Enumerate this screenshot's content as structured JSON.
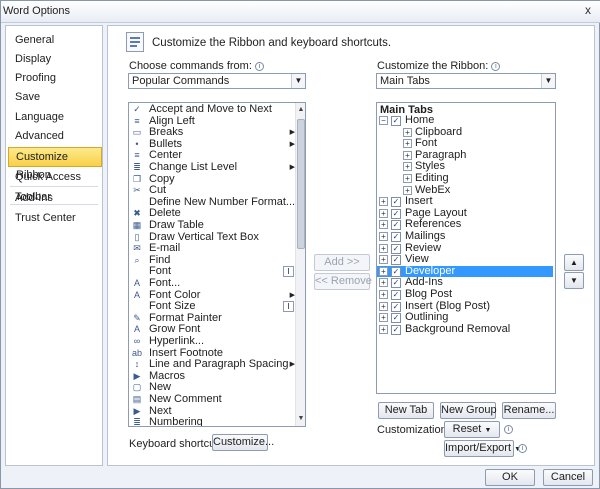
{
  "window": {
    "title": "Word Options",
    "close_glyph": "x"
  },
  "nav": {
    "items": [
      {
        "label": "General"
      },
      {
        "label": "Display"
      },
      {
        "label": "Proofing"
      },
      {
        "label": "Save"
      },
      {
        "label": "Language"
      },
      {
        "label": "Advanced"
      },
      {
        "label": "Customize Ribbon",
        "active": true
      },
      {
        "label": "Quick Access Toolbar"
      },
      {
        "label": "Add-Ins"
      },
      {
        "label": "Trust Center"
      }
    ]
  },
  "main": {
    "heading": "Customize the Ribbon and keyboard shortcuts.",
    "choose_label": "Choose commands from:",
    "choose_value": "Popular Commands",
    "customize_label": "Customize the Ribbon:",
    "customize_value": "Main Tabs",
    "commands": [
      {
        "label": "Accept and Move to Next",
        "icon": "accept-icon",
        "glyph": "✓"
      },
      {
        "label": "Align Left",
        "icon": "align-left-icon",
        "glyph": "≡"
      },
      {
        "label": "Breaks",
        "icon": "breaks-icon",
        "glyph": "▭",
        "submenu": true
      },
      {
        "label": "Bullets",
        "icon": "bullets-icon",
        "glyph": "•",
        "submenu": true
      },
      {
        "label": "Center",
        "icon": "center-icon",
        "glyph": "≡"
      },
      {
        "label": "Change List Level",
        "icon": "list-level-icon",
        "glyph": "≣",
        "submenu": true
      },
      {
        "label": "Copy",
        "icon": "copy-icon",
        "glyph": "❐"
      },
      {
        "label": "Cut",
        "icon": "cut-icon",
        "glyph": "✂"
      },
      {
        "label": "Define New Number Format...",
        "icon": "",
        "glyph": ""
      },
      {
        "label": "Delete",
        "icon": "delete-icon",
        "glyph": "✖"
      },
      {
        "label": "Draw Table",
        "icon": "draw-table-icon",
        "glyph": "▦"
      },
      {
        "label": "Draw Vertical Text Box",
        "icon": "text-box-icon",
        "glyph": "▯"
      },
      {
        "label": "E-mail",
        "icon": "email-icon",
        "glyph": "✉"
      },
      {
        "label": "Find",
        "icon": "find-icon",
        "glyph": "⌕"
      },
      {
        "label": "Font",
        "icon": "",
        "glyph": "",
        "ibeam": true
      },
      {
        "label": "Font...",
        "icon": "font-dialog-icon",
        "glyph": "A"
      },
      {
        "label": "Font Color",
        "icon": "font-color-icon",
        "glyph": "A",
        "submenu": true
      },
      {
        "label": "Font Size",
        "icon": "",
        "glyph": "",
        "ibeam": true
      },
      {
        "label": "Format Painter",
        "icon": "format-painter-icon",
        "glyph": "✎"
      },
      {
        "label": "Grow Font",
        "icon": "grow-font-icon",
        "glyph": "A"
      },
      {
        "label": "Hyperlink...",
        "icon": "hyperlink-icon",
        "glyph": "∞"
      },
      {
        "label": "Insert Footnote",
        "icon": "footnote-icon",
        "glyph": "ab"
      },
      {
        "label": "Line and Paragraph Spacing",
        "icon": "line-spacing-icon",
        "glyph": "↕",
        "submenu": true
      },
      {
        "label": "Macros",
        "icon": "macros-icon",
        "glyph": "▶"
      },
      {
        "label": "New",
        "icon": "new-icon",
        "glyph": "▢"
      },
      {
        "label": "New Comment",
        "icon": "new-comment-icon",
        "glyph": "▤"
      },
      {
        "label": "Next",
        "icon": "next-icon",
        "glyph": "▶"
      },
      {
        "label": "Numbering",
        "icon": "numbering-icon",
        "glyph": "≣"
      }
    ],
    "add_label": "Add >>",
    "remove_label": "<< Remove",
    "tree_header": "Main Tabs",
    "tree": [
      {
        "label": "Home",
        "level": 1,
        "expander": "⊟",
        "checked": true
      },
      {
        "label": "Clipboard",
        "level": 2,
        "expander": "⊞"
      },
      {
        "label": "Font",
        "level": 2,
        "expander": "⊞"
      },
      {
        "label": "Paragraph",
        "level": 2,
        "expander": "⊞"
      },
      {
        "label": "Styles",
        "level": 2,
        "expander": "⊞"
      },
      {
        "label": "Editing",
        "level": 2,
        "expander": "⊞"
      },
      {
        "label": "WebEx",
        "level": 2,
        "expander": "⊞"
      },
      {
        "label": "Insert",
        "level": 1,
        "expander": "⊞",
        "checked": true
      },
      {
        "label": "Page Layout",
        "level": 1,
        "expander": "⊞",
        "checked": true
      },
      {
        "label": "References",
        "level": 1,
        "expander": "⊞",
        "checked": true
      },
      {
        "label": "Mailings",
        "level": 1,
        "expander": "⊞",
        "checked": true
      },
      {
        "label": "Review",
        "level": 1,
        "expander": "⊞",
        "checked": true
      },
      {
        "label": "View",
        "level": 1,
        "expander": "⊞",
        "checked": true
      },
      {
        "label": "Developer",
        "level": 1,
        "expander": "⊞",
        "checked": true,
        "selected": true
      },
      {
        "label": "Add-Ins",
        "level": 1,
        "expander": "⊞",
        "checked": true
      },
      {
        "label": "Blog Post",
        "level": 1,
        "expander": "⊞",
        "checked": true
      },
      {
        "label": "Insert (Blog Post)",
        "level": 1,
        "expander": "⊞",
        "checked": true
      },
      {
        "label": "Outlining",
        "level": 1,
        "expander": "⊞",
        "checked": true
      },
      {
        "label": "Background Removal",
        "level": 1,
        "expander": "⊞",
        "checked": true
      }
    ],
    "new_tab_label": "New Tab",
    "new_group_label": "New Group",
    "rename_label": "Rename...",
    "customizations_label": "Customizations:",
    "reset_label": "Reset",
    "import_export_label": "Import/Export",
    "keyboard_label": "Keyboard shortcuts:",
    "customize_button_label": "Customize..."
  },
  "footer": {
    "ok_label": "OK",
    "cancel_label": "Cancel"
  }
}
